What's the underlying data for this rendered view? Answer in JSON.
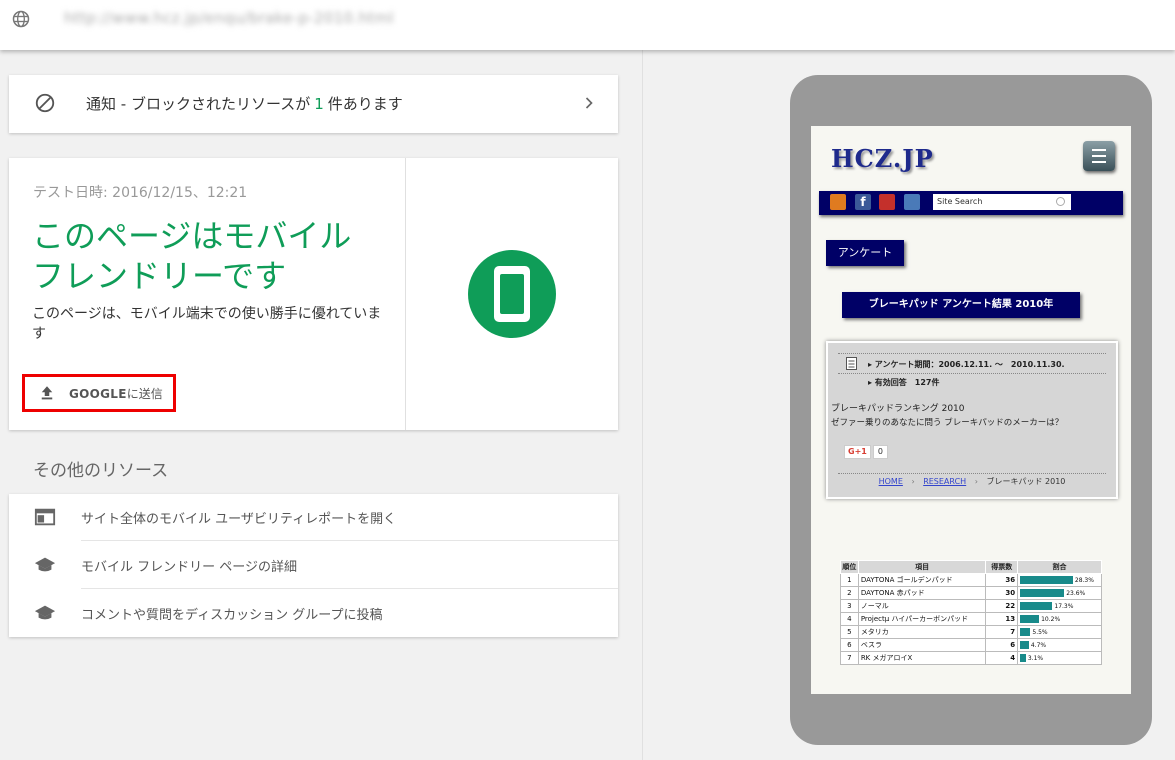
{
  "topbar": {
    "url": "http://www.hcz.jp/enqu/brake-p-2010.html"
  },
  "notice": {
    "prefix": "通知 - ブロックされたリソースが",
    "count": "1",
    "suffix": "件あります"
  },
  "result": {
    "test_date": "テスト日時: 2016/12/15、12:21",
    "headline": "このページはモバイル フレンドリーです",
    "description": "このページは、モバイル端末での使い勝手に優れています",
    "submit_brand": "GOOGLE",
    "submit_suffix": "に送信"
  },
  "other": {
    "title": "その他のリソース",
    "items": [
      {
        "label": "サイト全体のモバイル ユーザビリティレポートを開く",
        "icon": "browser-window-icon"
      },
      {
        "label": "モバイル フレンドリー ページの詳細",
        "icon": "graduation-cap-icon"
      },
      {
        "label": "コメントや質問をディスカッション グループに投稿",
        "icon": "graduation-cap-icon"
      }
    ]
  },
  "preview": {
    "logo": "HCZ.JP",
    "search_placeholder": "Site Search",
    "enquete_label": "アンケート",
    "page_heading": "ブレーキパッド アンケート結果 2010年",
    "period": "▸ アンケート期間：2006.12.11. ～　2010.11.30.",
    "responses": "▸ 有効回答　127件",
    "ranking_title": "ブレーキパッドランキング 2010",
    "ranking_question": "ゼファー乗りのあなたに問う ブレーキパッドのメーカーは？",
    "gplus_label": "G+1",
    "gplus_count": "0",
    "crumb_home": "HOME",
    "crumb_research": "RESEARCH",
    "crumb_current": "ブレーキパッド 2010",
    "table_headers": [
      "順位",
      "項目",
      "得票数",
      "割合"
    ],
    "table_rows": [
      {
        "rank": "1",
        "item": "DAYTONA ゴールデンパッド",
        "votes": "36",
        "pct_label": "28.3%",
        "pct": 28.3
      },
      {
        "rank": "2",
        "item": "DAYTONA 赤パッド",
        "votes": "30",
        "pct_label": "23.6%",
        "pct": 23.6
      },
      {
        "rank": "3",
        "item": "ノーマル",
        "votes": "22",
        "pct_label": "17.3%",
        "pct": 17.3
      },
      {
        "rank": "4",
        "item": "Projectμ ハイパーカーボンパッド",
        "votes": "13",
        "pct_label": "10.2%",
        "pct": 10.2
      },
      {
        "rank": "5",
        "item": "メタリカ",
        "votes": "7",
        "pct_label": "5.5%",
        "pct": 5.5
      },
      {
        "rank": "6",
        "item": "ベスラ",
        "votes": "6",
        "pct_label": "4.7%",
        "pct": 4.7
      },
      {
        "rank": "7",
        "item": "RK メガアロイX",
        "votes": "4",
        "pct_label": "3.1%",
        "pct": 3.1
      }
    ]
  },
  "colors": {
    "accent_green": "#0f9d58",
    "highlight_red": "#ee0000",
    "site_navy": "#000066",
    "bar_teal": "#188a8a"
  }
}
